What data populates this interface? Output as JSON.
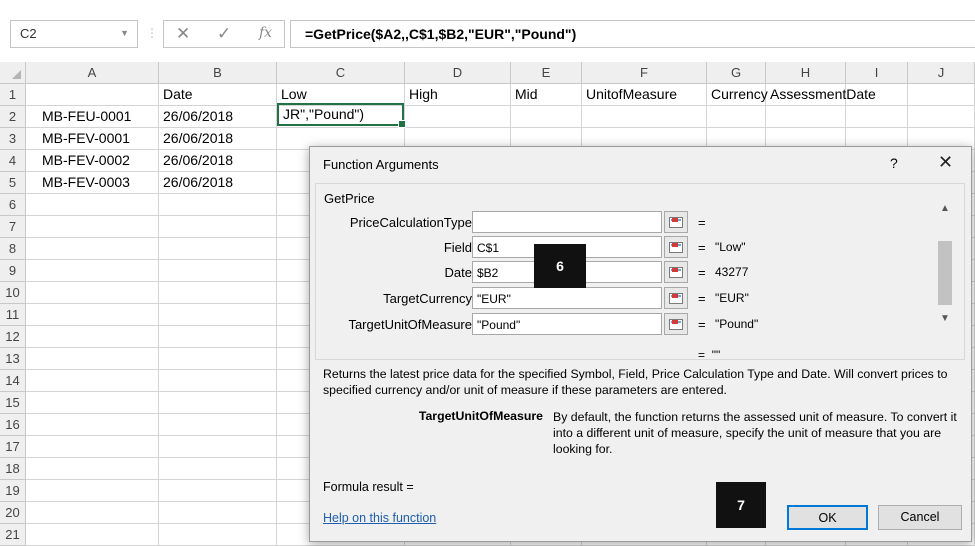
{
  "formula_bar": {
    "name_box": "C2",
    "cancel_icon": "✕",
    "enter_icon": "✓",
    "fx_label": "fx",
    "formula": "=GetPrice($A2,,C$1,$B2,\"EUR\",\"Pound\")"
  },
  "sheet": {
    "columns": [
      "A",
      "B",
      "C",
      "D",
      "E",
      "F",
      "G",
      "H",
      "I",
      "J"
    ],
    "row_numbers": [
      "1",
      "2",
      "3",
      "4",
      "5",
      "6",
      "7",
      "8",
      "9",
      "10",
      "11",
      "12",
      "13",
      "14",
      "15",
      "16",
      "17",
      "18",
      "19",
      "20",
      "21"
    ],
    "row1": [
      "",
      "Date",
      "Low",
      "High",
      "Mid",
      "UnitofMeasure",
      "Currency",
      "AssessmentDate"
    ],
    "data_rows": [
      [
        "MB-FEU-0001",
        "26/06/2018"
      ],
      [
        "MB-FEV-0001",
        "26/06/2018"
      ],
      [
        "MB-FEV-0002",
        "26/06/2018"
      ],
      [
        "MB-FEV-0003",
        "26/06/2018"
      ]
    ],
    "active_cell_text": "JR\",\"Pound\")"
  },
  "dialog": {
    "title": "Function Arguments",
    "help_icon": "?",
    "close_icon": "✕",
    "function_name": "GetPrice",
    "args": [
      {
        "label": "PriceCalculationType",
        "value": "",
        "result": ""
      },
      {
        "label": "Field",
        "value": "C$1",
        "result": "\"Low\""
      },
      {
        "label": "Date",
        "value": "$B2",
        "result": "43277"
      },
      {
        "label": "TargetCurrency",
        "value": "\"EUR\"",
        "result": "\"EUR\""
      },
      {
        "label": "TargetUnitOfMeasure",
        "value": "\"Pound\"",
        "result": "\"Pound\""
      }
    ],
    "eq_sign": "=",
    "function_result": "\"\"",
    "description": "Returns the latest price data for the specified Symbol, Field, Price Calculation Type and Date. Will convert prices to specified currency and/or unit of measure if these parameters are entered.",
    "param_name": "TargetUnitOfMeasure",
    "param_description": "By default, the function returns the assessed unit of measure. To convert it into a different unit of measure, specify the unit of measure that you are looking for.",
    "formula_result_label": "Formula result =",
    "help_link": "Help on this function",
    "ok_label": "OK",
    "cancel_label": "Cancel"
  },
  "badges": {
    "step6": "6",
    "step7": "7"
  }
}
